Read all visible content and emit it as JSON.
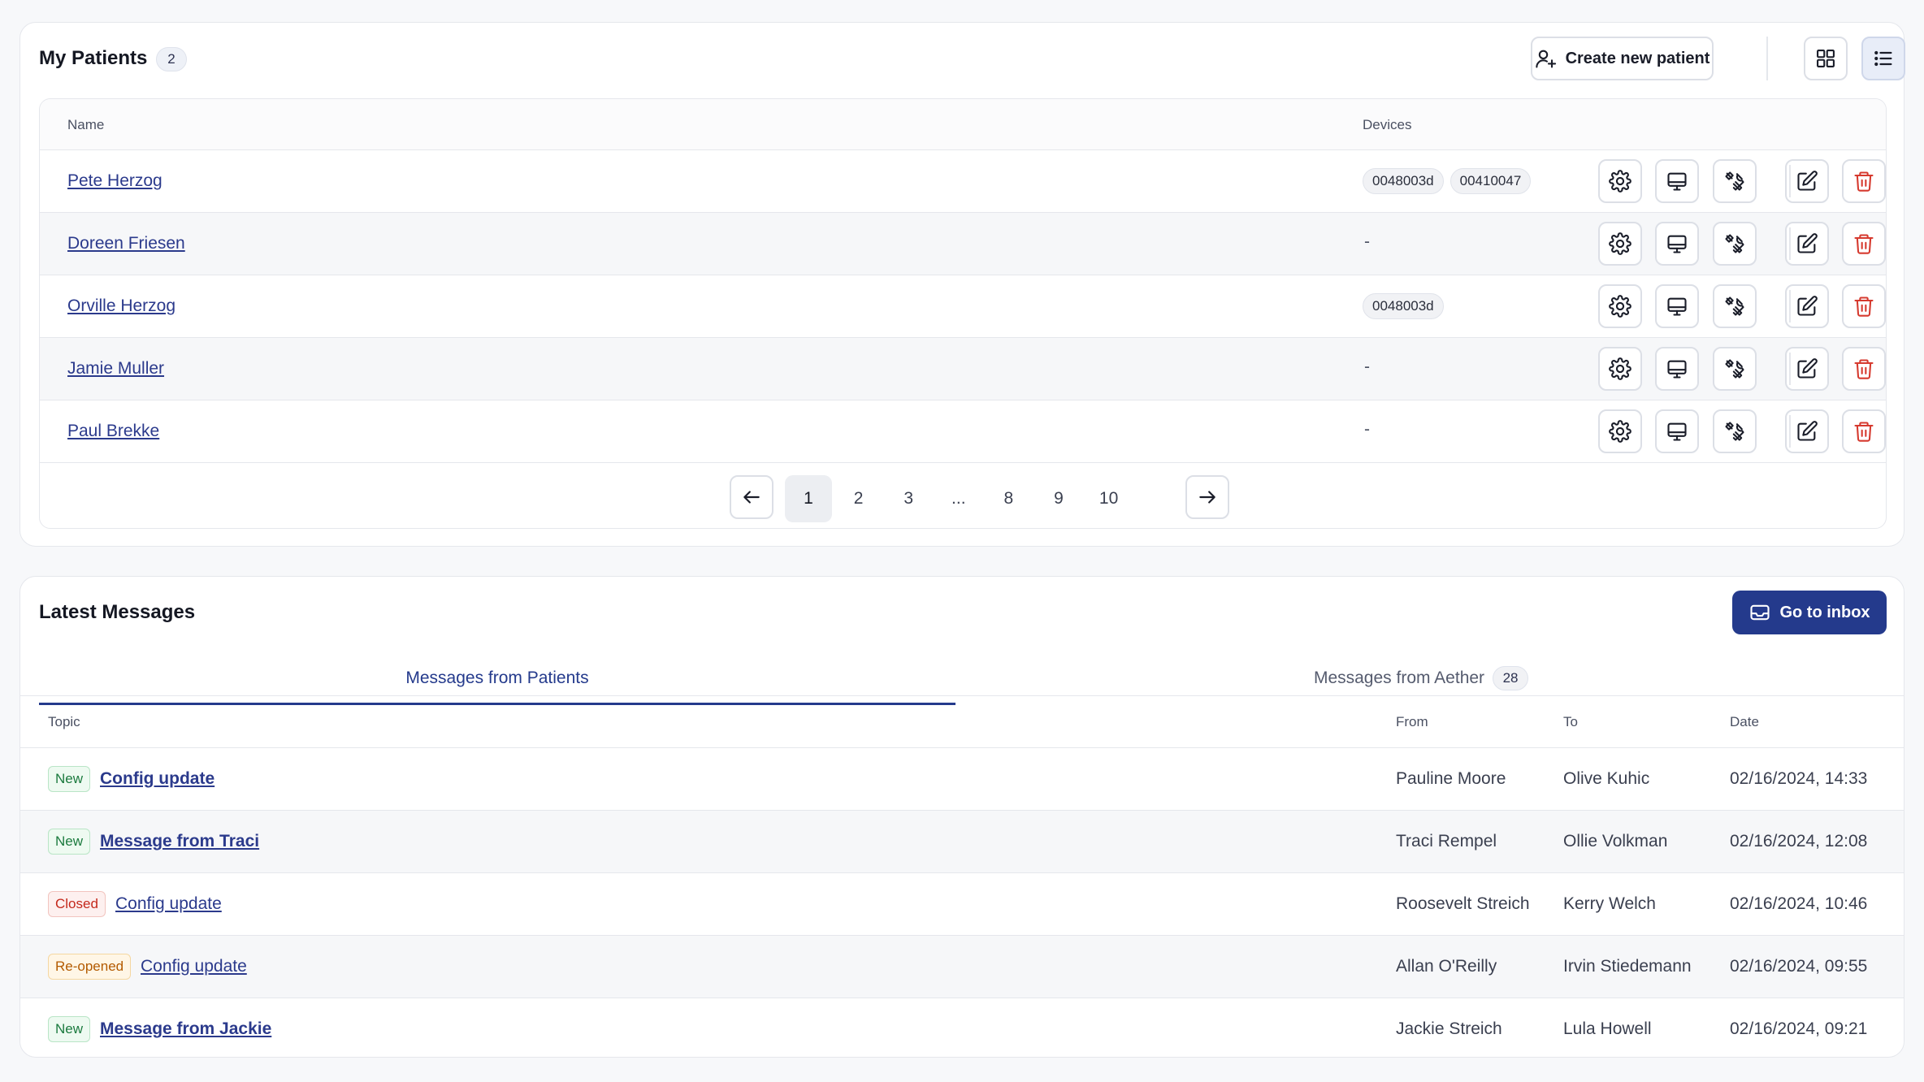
{
  "patients": {
    "title": "My Patients",
    "count": "2",
    "create_label": "Create new patient",
    "columns": {
      "name": "Name",
      "devices": "Devices"
    },
    "rows": [
      {
        "name": "Pete Herzog",
        "devices": [
          "0048003d",
          "00410047"
        ]
      },
      {
        "name": "Doreen Friesen",
        "devices": []
      },
      {
        "name": "Orville Herzog",
        "devices": [
          "0048003d"
        ]
      },
      {
        "name": "Jamie Muller",
        "devices": []
      },
      {
        "name": "Paul Brekke",
        "devices": []
      }
    ],
    "empty_devices": "-",
    "pagination": {
      "pages": [
        "1",
        "2",
        "3",
        "...",
        "8",
        "9",
        "10"
      ],
      "current": "1"
    }
  },
  "messages": {
    "title": "Latest Messages",
    "inbox_label": "Go to inbox",
    "tabs": [
      {
        "label": "Messages from Patients",
        "active": true
      },
      {
        "label": "Messages from Aether",
        "count": "28",
        "active": false
      }
    ],
    "columns": {
      "topic": "Topic",
      "from": "From",
      "to": "To",
      "date": "Date"
    },
    "rows": [
      {
        "status": "New",
        "status_kind": "new",
        "topic": "Config update",
        "unread": true,
        "from": "Pauline Moore",
        "to": "Olive Kuhic",
        "date": "02/16/2024, 14:33"
      },
      {
        "status": "New",
        "status_kind": "new",
        "topic": "Message from Traci",
        "unread": true,
        "from": "Traci Rempel",
        "to": "Ollie Volkman",
        "date": "02/16/2024, 12:08"
      },
      {
        "status": "Closed",
        "status_kind": "closed",
        "topic": "Config update",
        "unread": false,
        "from": "Roosevelt Streich",
        "to": "Kerry Welch",
        "date": "02/16/2024, 10:46"
      },
      {
        "status": "Re-opened",
        "status_kind": "reopened",
        "topic": "Config update",
        "unread": false,
        "from": "Allan O'Reilly",
        "to": "Irvin Stiedemann",
        "date": "02/16/2024, 09:55"
      },
      {
        "status": "New",
        "status_kind": "new",
        "topic": "Message from Jackie",
        "unread": true,
        "from": "Jackie Streich",
        "to": "Lula Howell",
        "date": "02/16/2024, 09:21"
      }
    ]
  },
  "colors": {
    "brand": "#243a8c",
    "danger": "#d63a2f",
    "link": "#2b3a8c"
  },
  "icons": {
    "create_patient": "user-plus-icon",
    "grid_view": "grid-icon",
    "list_view": "list-icon",
    "row_actions": [
      "gear-icon",
      "monitor-icon",
      "tools-icon",
      "edit-icon",
      "trash-icon"
    ],
    "pagination": [
      "arrow-left-icon",
      "arrow-right-icon"
    ],
    "inbox": "inbox-icon"
  }
}
